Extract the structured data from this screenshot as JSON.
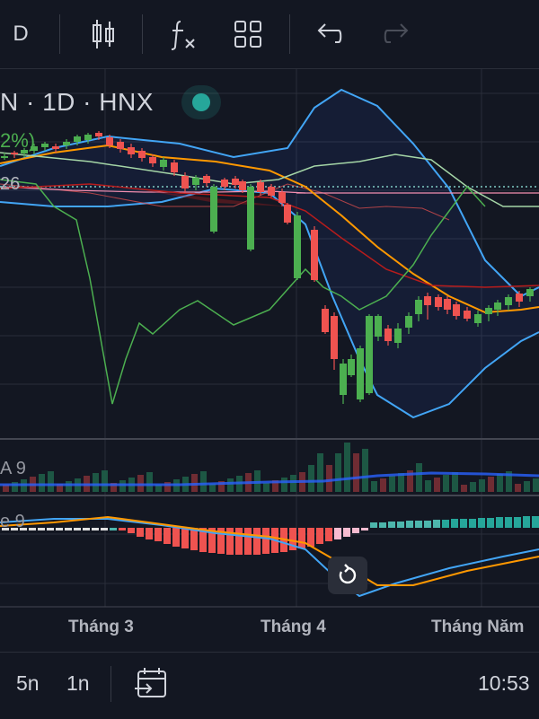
{
  "toolbar": {
    "interval_label": "D",
    "icons": [
      "candles-icon",
      "indicators-icon",
      "layout-icon",
      "undo-icon",
      "redo-icon"
    ]
  },
  "legend": {
    "symbol_line": "N · 1D · HNX",
    "change_text": "2%)",
    "price_label": "26",
    "volume_label": "A 9",
    "macd_label": "e 9"
  },
  "time_axis": {
    "months": [
      "Tháng 3",
      "Tháng 4",
      "Tháng Năm"
    ]
  },
  "bottom_bar": {
    "ranges": [
      "5n",
      "1n"
    ],
    "clock": "10:53"
  },
  "colors": {
    "background": "#131722",
    "up": "#4caf50",
    "down": "#ef5350",
    "bb_band": "#2962ff",
    "ma_orange": "#ff9800",
    "ma_green": "#66bb6a",
    "status_dot": "#26a69a"
  },
  "chart_data": {
    "type": "candlestick",
    "note_months": [
      "Tháng 3",
      "Tháng 4",
      "Tháng Năm"
    ]
  }
}
